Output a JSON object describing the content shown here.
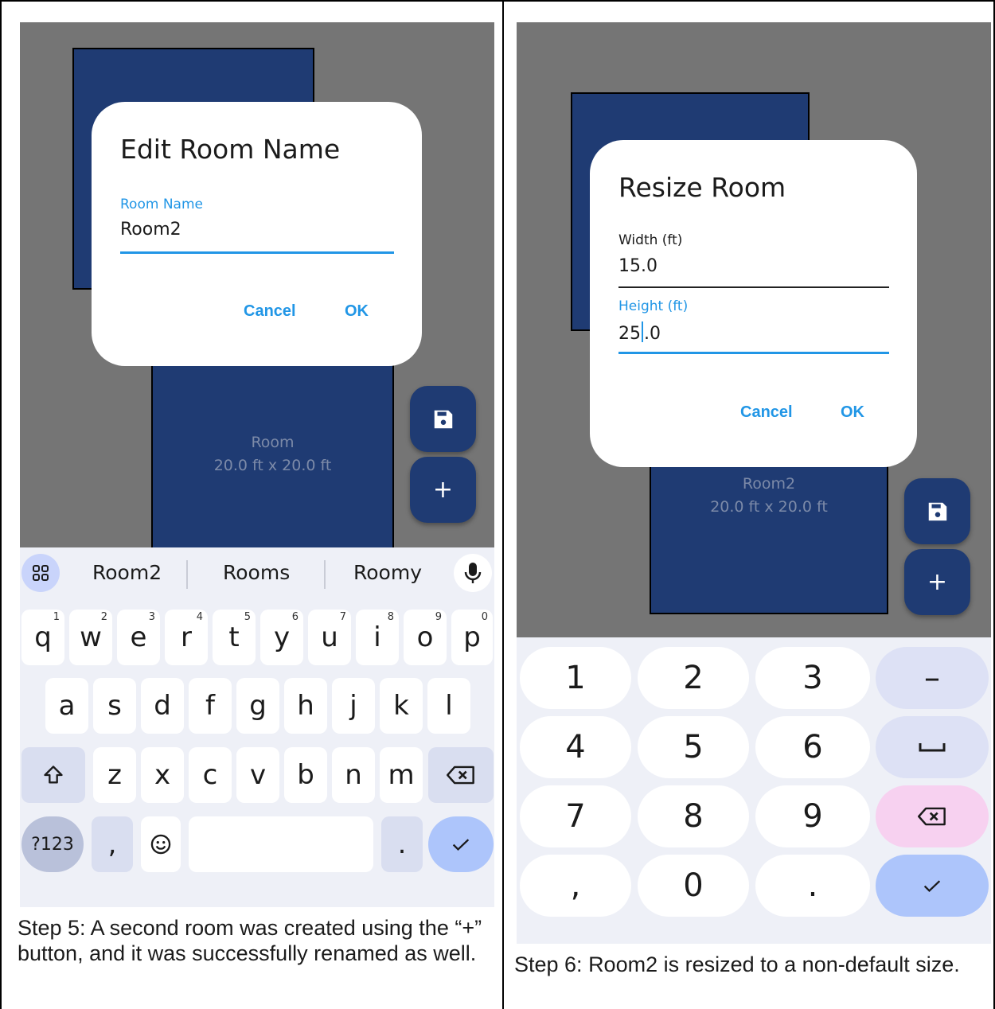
{
  "step5": {
    "dialog": {
      "title": "Edit Room Name",
      "field_label": "Room Name",
      "field_value": "Room2",
      "cancel": "Cancel",
      "ok": "OK"
    },
    "room": {
      "name": "Room",
      "size": "20.0 ft x 20.0 ft"
    },
    "suggestions": [
      "Room2",
      "Rooms",
      "Roomy"
    ],
    "keyboard": {
      "row1": [
        {
          "key": "q",
          "hint": "1"
        },
        {
          "key": "w",
          "hint": "2"
        },
        {
          "key": "e",
          "hint": "3"
        },
        {
          "key": "r",
          "hint": "4"
        },
        {
          "key": "t",
          "hint": "5"
        },
        {
          "key": "y",
          "hint": "6"
        },
        {
          "key": "u",
          "hint": "7"
        },
        {
          "key": "i",
          "hint": "8"
        },
        {
          "key": "o",
          "hint": "9"
        },
        {
          "key": "p",
          "hint": "0"
        }
      ],
      "row2": [
        "a",
        "s",
        "d",
        "f",
        "g",
        "h",
        "j",
        "k",
        "l"
      ],
      "row3": [
        "z",
        "x",
        "c",
        "v",
        "b",
        "n",
        "m"
      ],
      "symbols_key": "?123",
      "comma_key": ",",
      "period_key": "."
    },
    "caption": "Step 5: A second room was created using the “+” button, and it was successfully renamed as well."
  },
  "step6": {
    "dialog": {
      "title": "Resize Room",
      "width_label": "Width (ft)",
      "width_value": "15.0",
      "height_label": "Height (ft)",
      "height_value_before_cursor": "25",
      "height_value_after_cursor": ".0",
      "cancel": "Cancel",
      "ok": "OK"
    },
    "room": {
      "name": "Room2",
      "size": "20.0 ft x 20.0 ft"
    },
    "numpad": {
      "keys": [
        "1",
        "2",
        "3",
        "4",
        "5",
        "6",
        "7",
        "8",
        "9",
        ",",
        "0",
        "."
      ],
      "minus_key": "–"
    },
    "caption": "Step 6: Room2 is resized to a non-default size."
  },
  "colors": {
    "canvas": "#757575",
    "room": "#1f3b73",
    "accent": "#2196e6",
    "keyboard_bg": "#eef0f7",
    "delete_key": "#f7d1f0",
    "confirm_key": "#adc5fb"
  },
  "icons": [
    "save-icon",
    "plus-icon",
    "apps-grid-icon",
    "mic-icon",
    "shift-icon",
    "backspace-icon",
    "emoji-icon",
    "checkmark-icon",
    "space-icon"
  ]
}
